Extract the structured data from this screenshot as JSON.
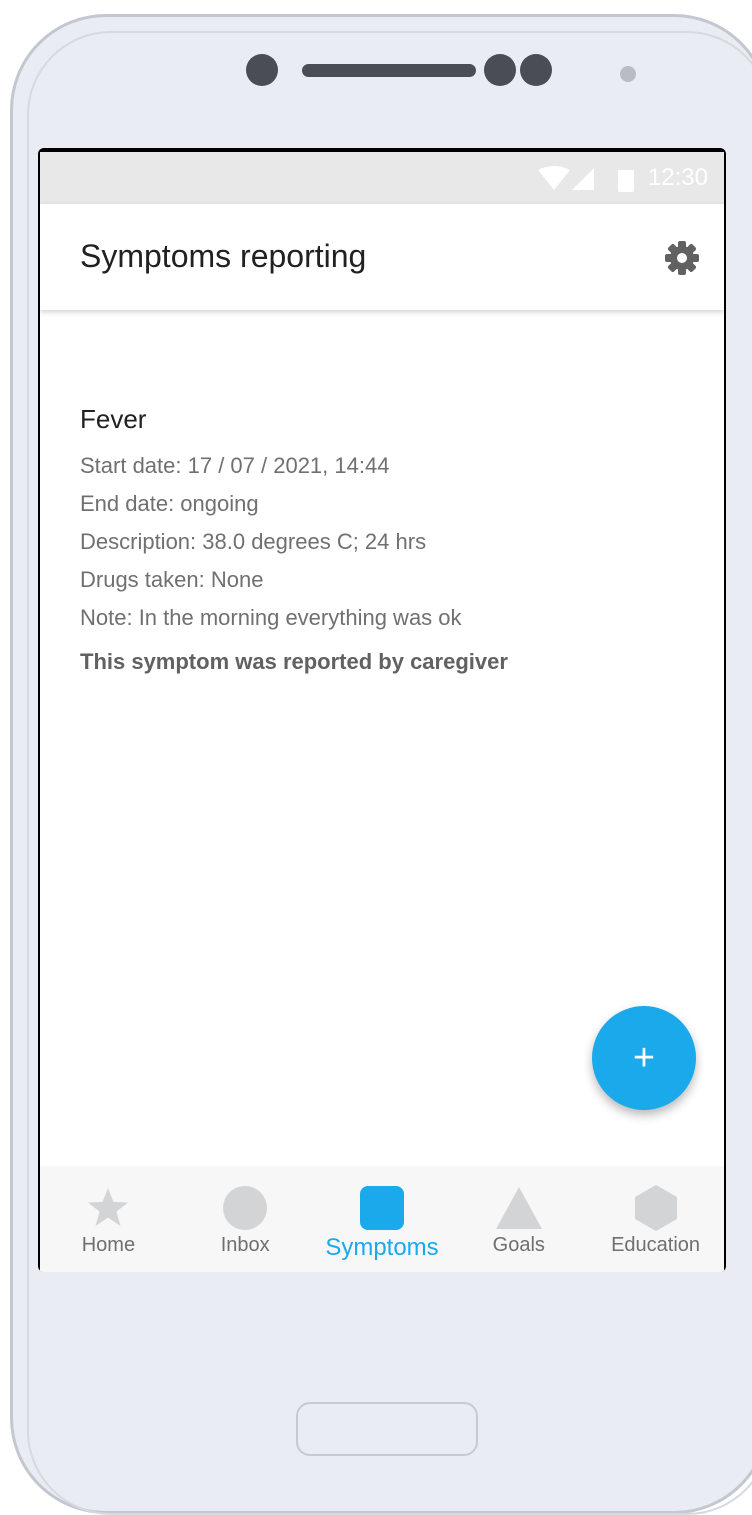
{
  "status_bar": {
    "time": "12:30",
    "icons": [
      "wifi-icon",
      "signal-icon",
      "battery-icon"
    ]
  },
  "header": {
    "title": "Symptoms reporting",
    "settings_icon": "gear-icon"
  },
  "symptom": {
    "name": "Fever",
    "start_date": "Start date: 17 / 07 / 2021, 14:44",
    "end_date": "End date: ongoing",
    "description": "Description: 38.0 degrees C; 24 hrs",
    "drugs": "Drugs taken: None",
    "note": "Note: In the morning everything was ok",
    "reported_by": "This symptom was reported by caregiver"
  },
  "fab": {
    "label": "+",
    "icon": "plus-icon"
  },
  "bottom_nav": {
    "items": [
      {
        "label": "Home",
        "icon": "star-icon",
        "active": false
      },
      {
        "label": "Inbox",
        "icon": "circle-icon",
        "active": false
      },
      {
        "label": "Symptoms",
        "icon": "square-icon",
        "active": true
      },
      {
        "label": "Goals",
        "icon": "triangle-icon",
        "active": false
      },
      {
        "label": "Education",
        "icon": "hexagon-icon",
        "active": false
      }
    ]
  },
  "system_nav": {
    "icons": [
      "back-icon",
      "home-circle-icon",
      "recents-icon"
    ]
  },
  "colors": {
    "accent": "#1aa9ea",
    "inactive_icon": "#d3d4d6",
    "frame": "#e9ecf2"
  }
}
